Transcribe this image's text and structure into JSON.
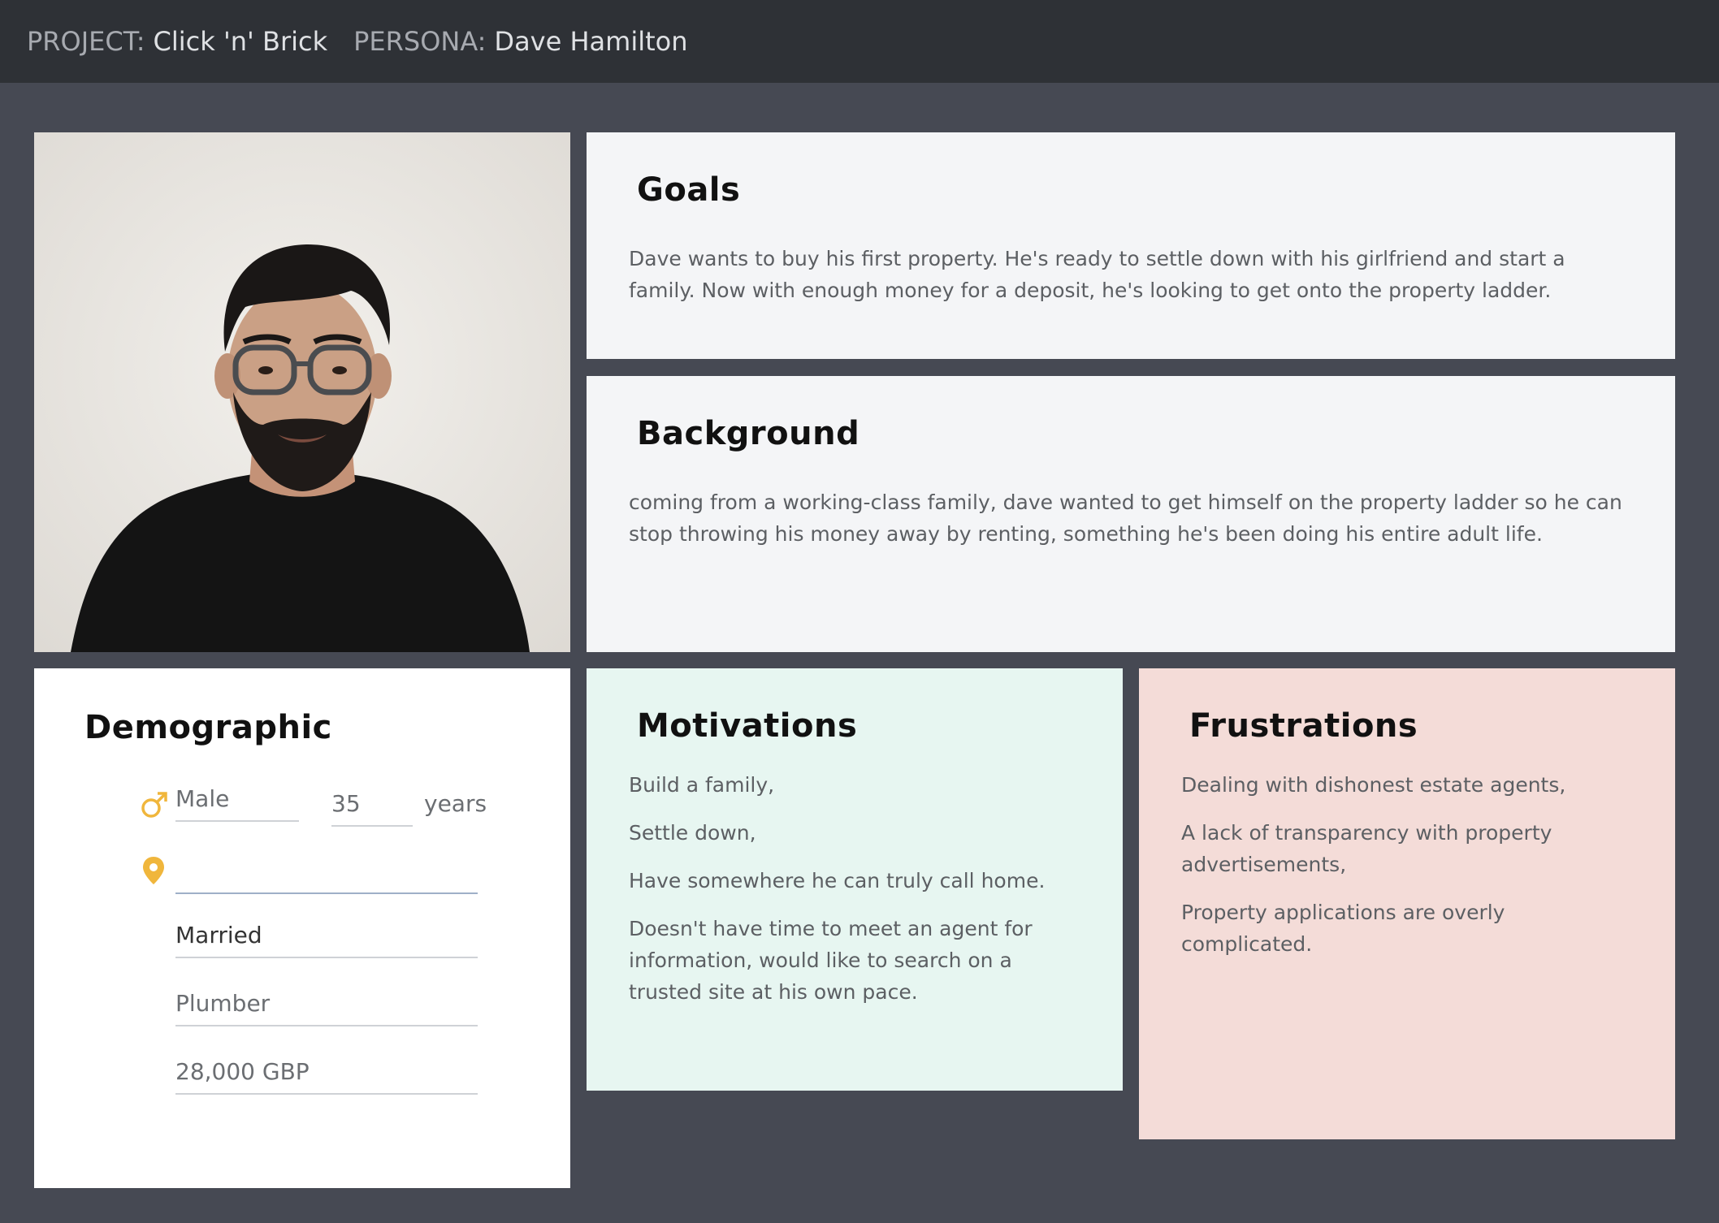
{
  "header": {
    "project_label": "PROJECT:",
    "project_name": "Click 'n' Brick",
    "persona_label": "PERSONA:",
    "persona_name": "Dave Hamilton"
  },
  "goals": {
    "title": "Goals",
    "text": "Dave wants to buy his first property. He's ready to settle down with his girlfriend and start a family. Now with enough money for a deposit, he's looking to get onto the property ladder."
  },
  "background": {
    "title": "Background",
    "text": "coming from a working-class family, dave wanted to get himself on the property ladder so he can stop throwing his money away by renting, something he's been doing his entire adult life."
  },
  "demographic": {
    "title": "Demographic",
    "gender": "Male",
    "age": "35",
    "age_unit": "years",
    "location": "",
    "marital_status": "Married",
    "occupation": "Plumber",
    "income": "28,000 GBP"
  },
  "motivations": {
    "title": "Motivations",
    "items": [
      "Build a family,",
      "Settle down,",
      "Have somewhere he can truly call home.",
      "Doesn't have time to meet an agent for information, would like to search on a trusted site at his own pace."
    ]
  },
  "frustrations": {
    "title": "Frustrations",
    "items": [
      "Dealing with dishonest estate agents,",
      "A lack of transparency with property advertisements,",
      "Property applications are overly complicated."
    ]
  },
  "colors": {
    "accent_icon": "#f0b63c",
    "page_bg": "#464953",
    "header_bg": "#2e3136",
    "motivations_bg": "#e7f6f1",
    "frustrations_bg": "#f4dcd8"
  },
  "icons": {
    "gender": "male-symbol-icon",
    "location": "location-pin-icon"
  }
}
